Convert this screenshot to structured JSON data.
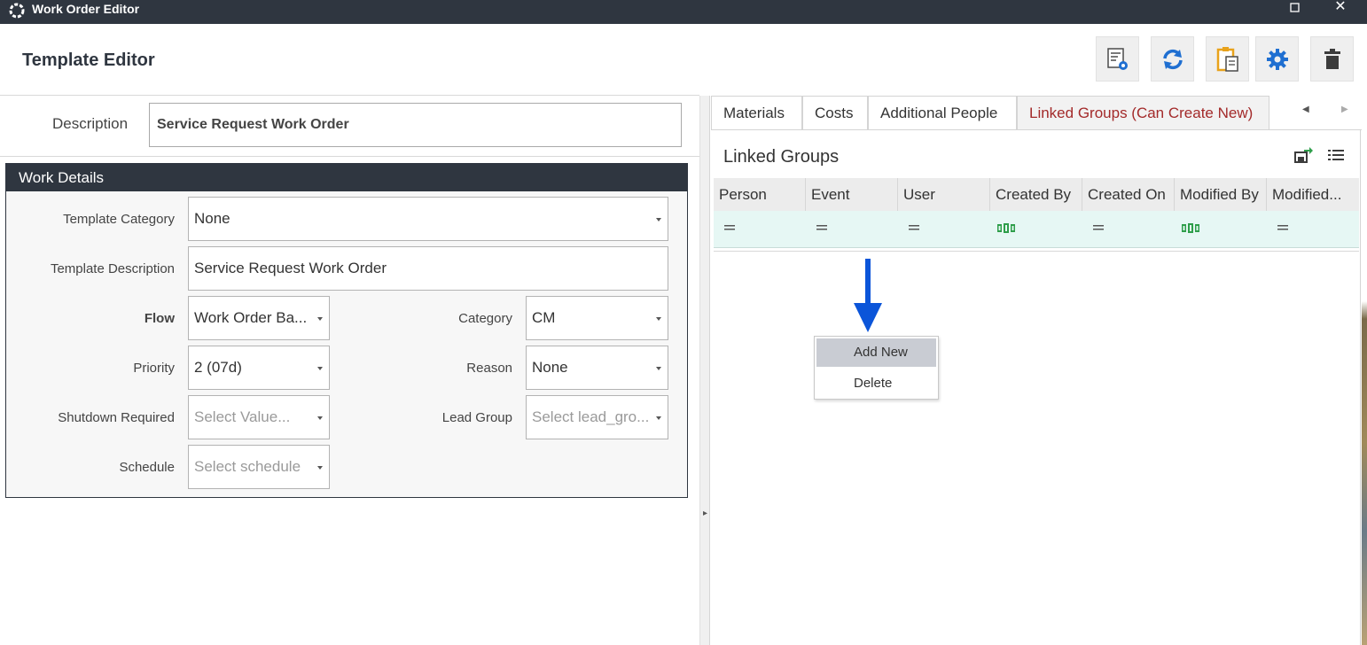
{
  "window": {
    "title": "Work Order Editor",
    "maximize_glyph": "☐",
    "close_glyph": "✕"
  },
  "header": {
    "title": "Template Editor",
    "toolbar": [
      {
        "name": "form-settings-icon"
      },
      {
        "name": "refresh-icon"
      },
      {
        "name": "clipboard-icon"
      },
      {
        "name": "gear-icon"
      },
      {
        "name": "trash-icon"
      }
    ]
  },
  "description": {
    "label": "Description",
    "value": "Service Request Work Order"
  },
  "work_details": {
    "title": "Work Details",
    "template_category": {
      "label": "Template Category",
      "value": "None"
    },
    "template_description": {
      "label": "Template Description",
      "value": "Service Request Work Order"
    },
    "flow": {
      "label": "Flow",
      "value": "Work Order Ba..."
    },
    "category": {
      "label": "Category",
      "value": "CM"
    },
    "priority": {
      "label": "Priority",
      "value": "2 (07d)"
    },
    "reason": {
      "label": "Reason",
      "value": "None"
    },
    "shutdown_required": {
      "label": "Shutdown Required",
      "placeholder": "Select Value..."
    },
    "lead_group": {
      "label": "Lead Group",
      "placeholder": "Select lead_gro..."
    },
    "schedule": {
      "label": "Schedule",
      "placeholder": "Select schedule"
    }
  },
  "tabs": [
    {
      "label": "Materials"
    },
    {
      "label": "Costs"
    },
    {
      "label": "Additional People"
    },
    {
      "label": "Linked Groups (Can Create New)",
      "active": true
    }
  ],
  "linked_groups": {
    "title": "Linked Groups",
    "columns": [
      "Person",
      "Event",
      "User",
      "Created By",
      "Created On",
      "Modified By",
      "Modified..."
    ],
    "filter_icons": [
      "equals-icon",
      "equals-icon",
      "equals-icon",
      "abc-icon",
      "equals-icon",
      "abc-icon",
      "equals-icon"
    ]
  },
  "context_menu": {
    "items": [
      {
        "label": "Add New"
      },
      {
        "label": "Delete"
      }
    ]
  },
  "colors": {
    "titlebar": "#2f3640",
    "accent_blue": "#1f6fd1",
    "active_tab_text": "#a32a2a",
    "filter_row": "#e6f7f4",
    "arrow_blue": "#0b55d9"
  }
}
